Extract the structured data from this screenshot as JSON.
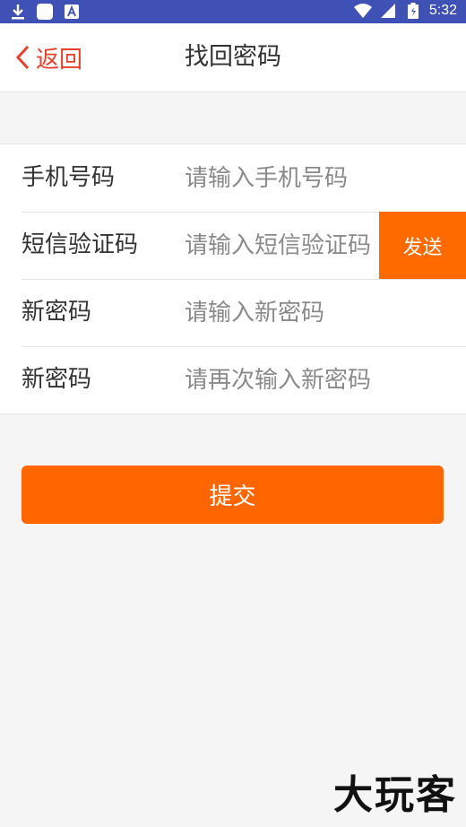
{
  "status_bar": {
    "time": "5:32"
  },
  "nav": {
    "back_label": "返回",
    "title": "找回密码"
  },
  "form": {
    "rows": [
      {
        "label": "手机号码",
        "placeholder": "请输入手机号码"
      },
      {
        "label": "短信验证码",
        "placeholder": "请输入短信验证码"
      },
      {
        "label": "新密码",
        "placeholder": "请输入新密码"
      },
      {
        "label": "新密码",
        "placeholder": "请再次输入新密码"
      }
    ],
    "send_label": "发送"
  },
  "submit_label": "提交",
  "watermark": "大玩客",
  "colors": {
    "accent": "#ff6600",
    "status_bar": "#3f51b5",
    "back": "#e8402a"
  }
}
